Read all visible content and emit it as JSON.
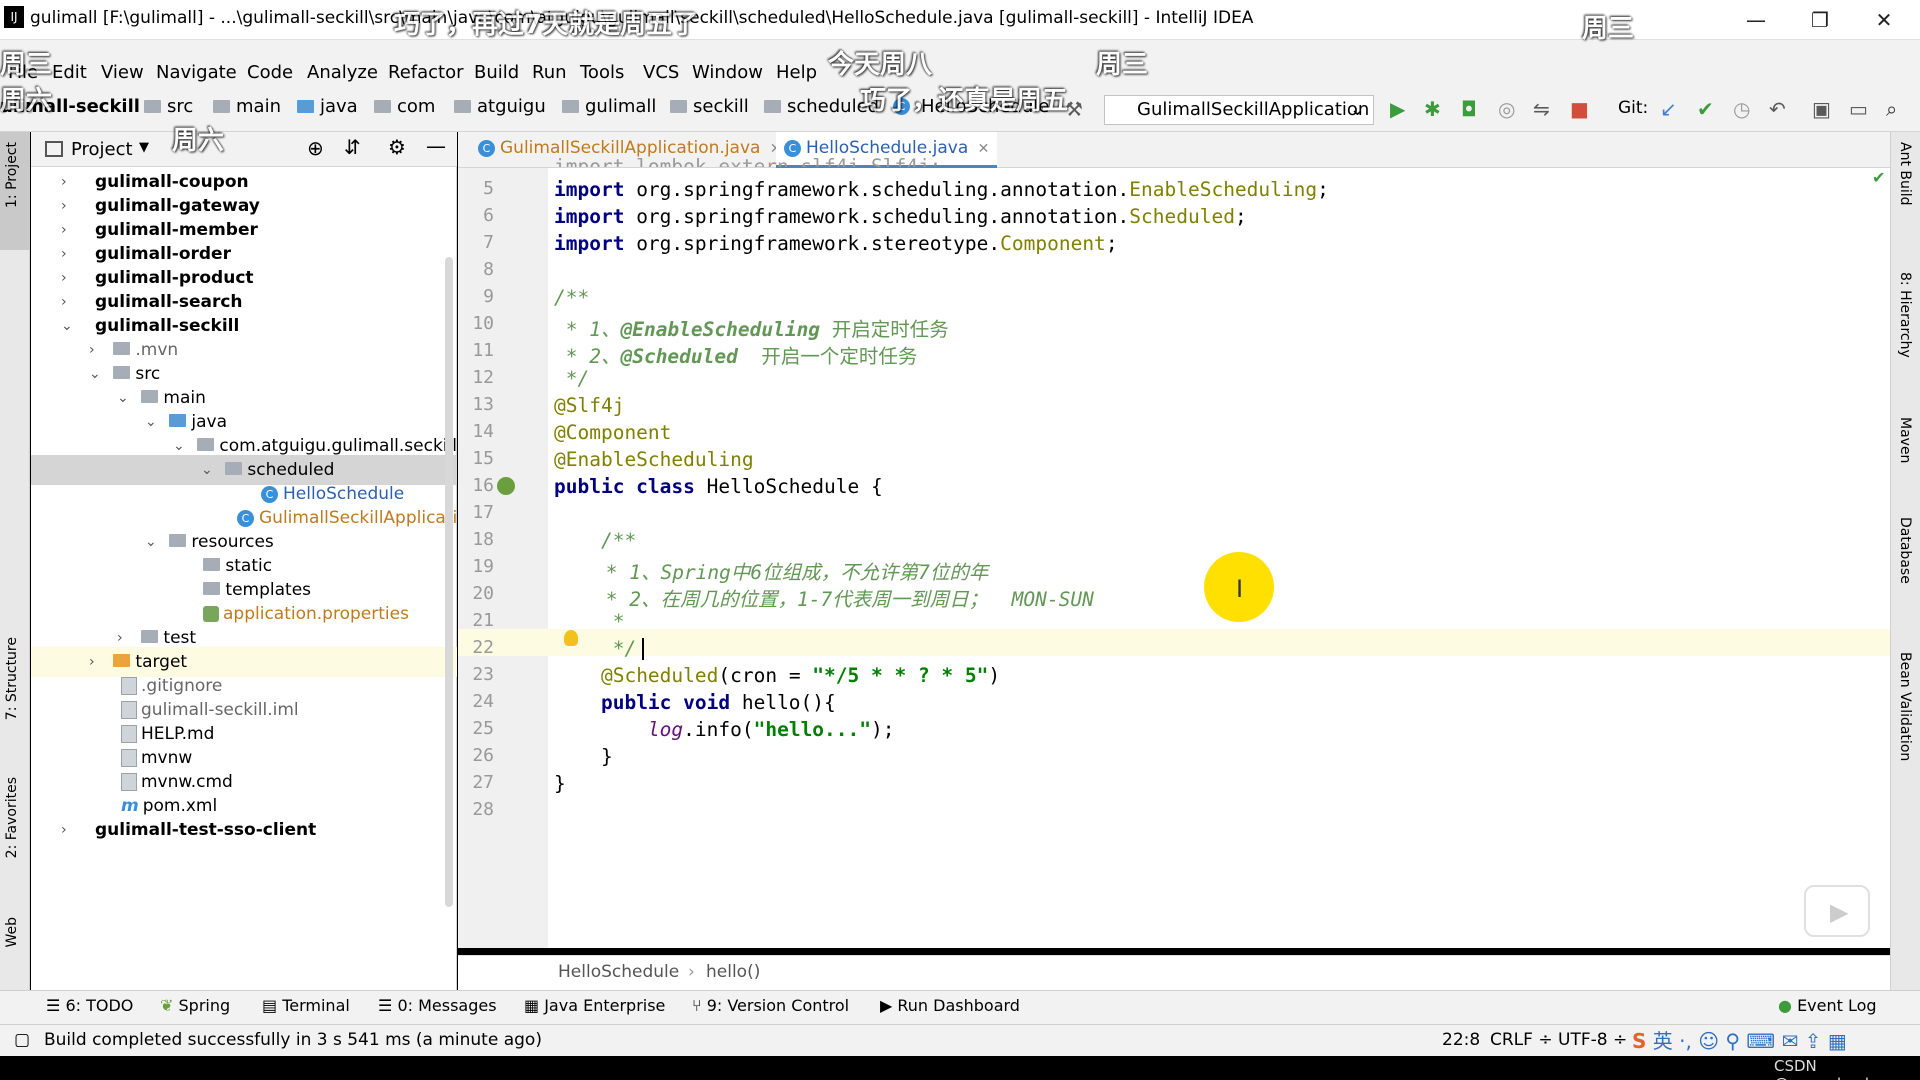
{
  "titlebar": {
    "title": "gulimall [F:\\gulimall] - ...\\gulimall-seckill\\src\\main\\java\\com\\atguigu\\gulimall\\seckill\\scheduled\\HelloSchedule.java [gulimall-seckill] - IntelliJ IDEA",
    "minimize": "—",
    "restore": "❐",
    "close": "✕"
  },
  "menu": [
    "File",
    "Edit",
    "View",
    "Navigate",
    "Code",
    "Analyze",
    "Refactor",
    "Build",
    "Run",
    "Tools",
    "VCS",
    "Window",
    "Help"
  ],
  "nav": {
    "crumbs": [
      "ulimall-seckill",
      "src",
      "main",
      "java",
      "com",
      "atguigu",
      "gulimall",
      "seckill",
      "scheduled",
      "HelloSchedule"
    ],
    "run_config": "GulimallSeckillApplication",
    "git_label": "Git:"
  },
  "left_tools": {
    "project": "1: Project",
    "structure": "7: Structure",
    "favorites": "2: Favorites",
    "web": "Web"
  },
  "right_tools": {
    "ant": "Ant Build",
    "hierarchy": "8: Hierarchy",
    "maven": "Maven",
    "database": "Database",
    "bean": "Bean Validation"
  },
  "project_panel": {
    "title": "Project",
    "tree": [
      {
        "label": "gulimall-coupon",
        "bold": true
      },
      {
        "label": "gulimall-gateway",
        "bold": true
      },
      {
        "label": "gulimall-member",
        "bold": true
      },
      {
        "label": "gulimall-order",
        "bold": true
      },
      {
        "label": "gulimall-product",
        "bold": true
      },
      {
        "label": "gulimall-search",
        "bold": true
      },
      {
        "label": "gulimall-seckill",
        "bold": true
      },
      {
        "label": ".mvn"
      },
      {
        "label": "src"
      },
      {
        "label": "main"
      },
      {
        "label": "java"
      },
      {
        "label": "com.atguigu.gulimall.seckill"
      },
      {
        "label": "scheduled"
      },
      {
        "label": "HelloSchedule"
      },
      {
        "label": "GulimallSeckillApplication"
      },
      {
        "label": "resources"
      },
      {
        "label": "static"
      },
      {
        "label": "templates"
      },
      {
        "label": "application.properties"
      },
      {
        "label": "test"
      },
      {
        "label": "target"
      },
      {
        "label": ".gitignore"
      },
      {
        "label": "gulimall-seckill.iml"
      },
      {
        "label": "HELP.md"
      },
      {
        "label": "mvnw"
      },
      {
        "label": "mvnw.cmd"
      },
      {
        "label": "pom.xml"
      },
      {
        "label": "gulimall-test-sso-client",
        "bold": true
      }
    ]
  },
  "tabs": [
    {
      "label": "GulimallSeckillApplication.java",
      "active": false
    },
    {
      "label": "HelloSchedule.java",
      "active": true
    }
  ],
  "editor": {
    "line_numbers": [
      "5",
      "6",
      "7",
      "8",
      "9",
      "10",
      "11",
      "12",
      "13",
      "14",
      "15",
      "16",
      "17",
      "18",
      "19",
      "20",
      "21",
      "22",
      "23",
      "24",
      "25",
      "26",
      "27",
      "28"
    ],
    "comment1_l1": "@EnableScheduling",
    "comment1_l1_cn": " 开启定时任务",
    "comment1_l2": "@Scheduled",
    "comment1_l2_cn": "  开启一个定时任务",
    "comment2_l1": " * 1、Spring中6位组成，不允许第7位的年",
    "comment2_l2": " * 2、在周几的位置，1-7代表周一到周日；  MON-SUN",
    "cron": "\"*/5 * * ? * 5\"",
    "log_str": "\"hello...\""
  },
  "breadcrumbs": {
    "class": "HelloSchedule",
    "method": "hello()"
  },
  "toolwindows": [
    "6: TODO",
    "Spring",
    "Terminal",
    "0: Messages",
    "Java Enterprise",
    "9: Version Control",
    "Run Dashboard",
    "Event Log"
  ],
  "status": {
    "message": "Build completed successfully in 3 s 541 ms (a minute ago)",
    "position": "22:8",
    "line_sep": "CRLF ÷",
    "encoding": "UTF-8 ÷",
    "watermark": "CSDN @wang_book"
  },
  "overlay": {
    "danmu": [
      "巧了，再过7天就是周五了",
      "今天周八",
      "周三",
      "巧了，还真是周五",
      "周三",
      "周六",
      "周三",
      "周六"
    ]
  }
}
